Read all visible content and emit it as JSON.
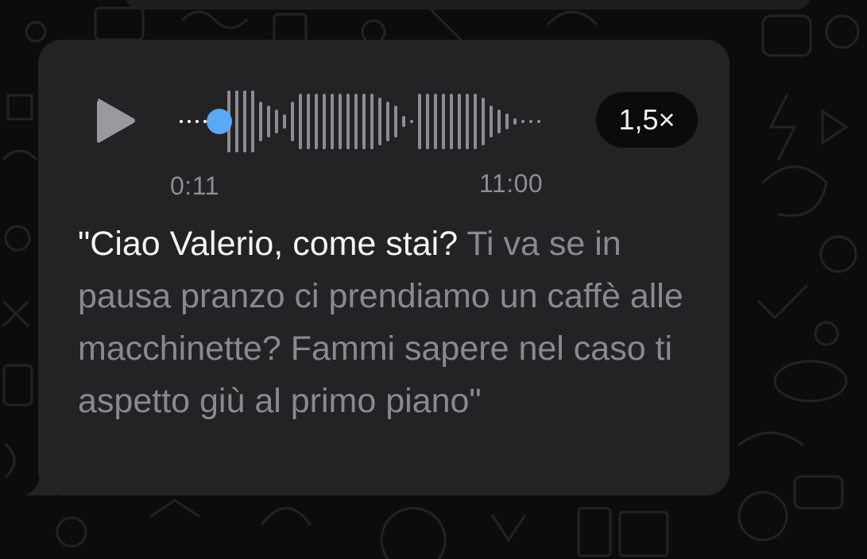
{
  "voice_message": {
    "elapsed_time": "0:11",
    "total_time": "11:00",
    "playback_speed": "1,5×",
    "progress_fraction": 0.043,
    "colors": {
      "bubble": "#232325",
      "played_bars": "#ffffff",
      "unplayed_bars": "#8e8e92",
      "progress_knob": "#5aa9f5"
    }
  },
  "transcript": {
    "spoken_part": "\"Ciao Valerio, come stai?",
    "remaining_part": "Ti va se in pausa pranzo ci prendiamo un caffè alle macchinette? Fammi sapere nel caso ti aspetto giù al primo piano\""
  },
  "icons": {
    "play": "play-icon"
  }
}
